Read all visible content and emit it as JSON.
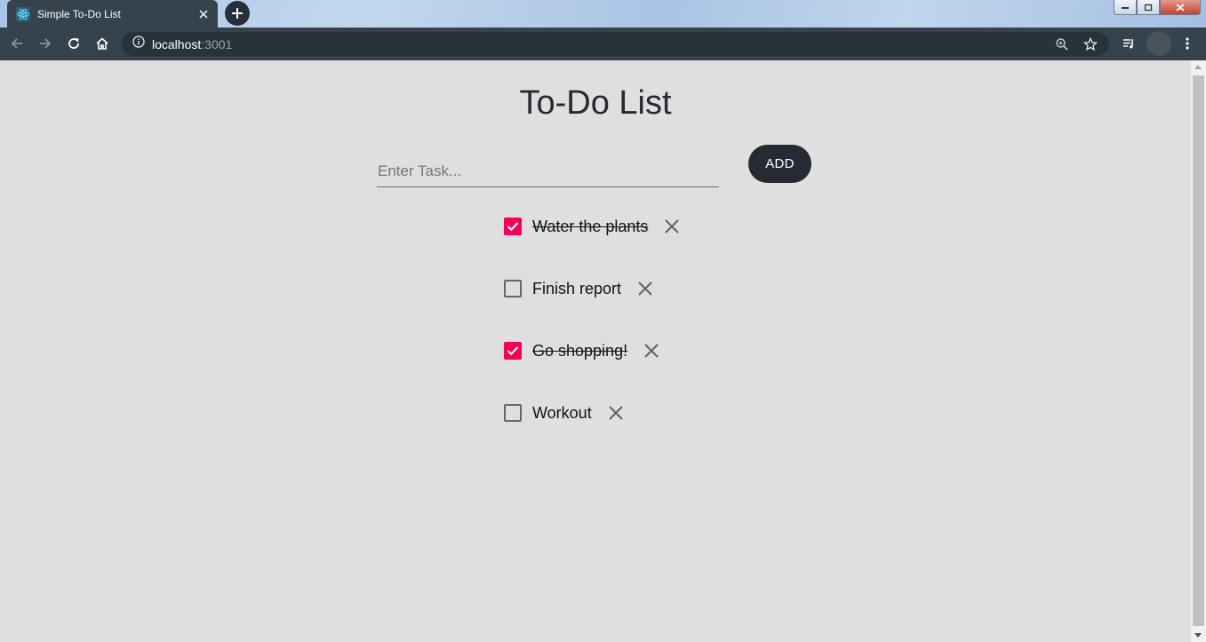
{
  "browser": {
    "tab_title": "Simple To-Do List",
    "url_host": "localhost",
    "url_port": ":3001"
  },
  "app": {
    "title": "To-Do List",
    "input_placeholder": "Enter Task...",
    "input_value": "",
    "add_label": "ADD",
    "accent_color": "#f50057",
    "button_color": "#262b33",
    "tasks": [
      {
        "text": "Water the plants",
        "done": true
      },
      {
        "text": "Finish report",
        "done": false
      },
      {
        "text": "Go shopping!",
        "done": true
      },
      {
        "text": "Workout",
        "done": false
      }
    ]
  }
}
